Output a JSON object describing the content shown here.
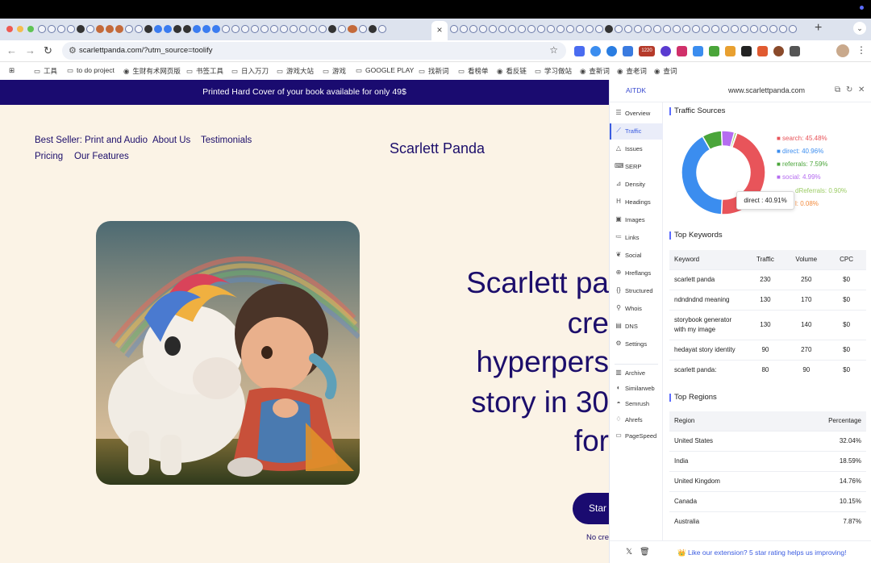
{
  "browser": {
    "active_tab_close": "×",
    "new_tab": "+",
    "tab_menu": "⌄",
    "url": "scarlettpanda.com/?utm_source=toolify",
    "bookmarks": [
      {
        "label": "工具"
      },
      {
        "label": "to do project"
      },
      {
        "label": "生财有术网页版"
      },
      {
        "label": "书签工具"
      },
      {
        "label": "日入万刀"
      },
      {
        "label": "游戏大站"
      },
      {
        "label": "游戏"
      },
      {
        "label": "GOOGLE PLAY"
      },
      {
        "label": "找新词"
      },
      {
        "label": "看榜单"
      },
      {
        "label": "看反链"
      },
      {
        "label": "学习做站"
      },
      {
        "label": "查新词"
      },
      {
        "label": "查老词"
      },
      {
        "label": "查词"
      }
    ],
    "extension_badge": "1220"
  },
  "site": {
    "banner": "Printed Hard Cover of your book available for only 49$",
    "nav": {
      "best_seller": "Best Seller: Print and Audio",
      "about": "About Us",
      "testimonials": "Testimonials",
      "pricing": "Pricing",
      "features": "Our Features"
    },
    "logo": "Scarlett Panda",
    "hero_lines": [
      "Scarlett pa",
      "cre",
      "hyperpers",
      "story in 30",
      "for"
    ],
    "cta": "Star",
    "subtext": "No cre"
  },
  "panel": {
    "brand": "AITDK",
    "domain": "www.scarlettpanda.com",
    "nav": [
      {
        "label": "Overview",
        "icon": "list-icon"
      },
      {
        "label": "Traffic",
        "icon": "chart-line-icon",
        "active": true
      },
      {
        "label": "Issues",
        "icon": "warning-icon"
      },
      {
        "label": "SERP",
        "icon": "serp-icon"
      },
      {
        "label": "Density",
        "icon": "density-icon"
      },
      {
        "label": "Headings",
        "icon": "heading-icon"
      },
      {
        "label": "Images",
        "icon": "image-icon"
      },
      {
        "label": "Links",
        "icon": "links-icon"
      },
      {
        "label": "Social",
        "icon": "twitter-icon"
      },
      {
        "label": "Hreflangs",
        "icon": "globe-icon"
      },
      {
        "label": "Structured",
        "icon": "braces-icon"
      },
      {
        "label": "Whois",
        "icon": "user-search-icon"
      },
      {
        "label": "DNS",
        "icon": "dns-icon"
      },
      {
        "label": "Settings",
        "icon": "gear-icon"
      },
      {
        "label": "Archive",
        "icon": "archive-icon"
      },
      {
        "label": "Similarweb",
        "icon": "similarweb-icon"
      },
      {
        "label": "Semrush",
        "icon": "semrush-icon"
      },
      {
        "label": "Ahrefs",
        "icon": "ahrefs-icon"
      },
      {
        "label": "PageSpeed",
        "icon": "pagespeed-icon"
      }
    ],
    "traffic_title": "Traffic Sources",
    "keywords_title": "Top Keywords",
    "regions_title": "Top Regions",
    "tooltip": "direct : 40.91%",
    "keyword_headers": [
      "Keyword",
      "Traffic",
      "Volume",
      "CPC"
    ],
    "keywords": [
      {
        "keyword": "scarlett panda",
        "traffic": "230",
        "volume": "250",
        "cpc": "$0"
      },
      {
        "keyword": "ndndndnd meaning",
        "traffic": "130",
        "volume": "170",
        "cpc": "$0"
      },
      {
        "keyword": "storybook generator with my image",
        "traffic": "130",
        "volume": "140",
        "cpc": "$0"
      },
      {
        "keyword": "hedayat story identity",
        "traffic": "90",
        "volume": "270",
        "cpc": "$0"
      },
      {
        "keyword": "scarlett panda:",
        "traffic": "80",
        "volume": "90",
        "cpc": "$0"
      }
    ],
    "region_headers": [
      "Region",
      "Percentage"
    ],
    "regions": [
      {
        "region": "United States",
        "pct": "32.04%"
      },
      {
        "region": "India",
        "pct": "18.59%"
      },
      {
        "region": "United Kingdom",
        "pct": "14.76%"
      },
      {
        "region": "Canada",
        "pct": "10.15%"
      },
      {
        "region": "Australia",
        "pct": "7.87%"
      }
    ],
    "footer_message": "👑 Like our extension? 5 star rating helps us improving!"
  },
  "chart_data": {
    "type": "pie",
    "donut": true,
    "categories": [
      "search",
      "direct",
      "referrals",
      "social",
      "paidReferrals",
      "mail"
    ],
    "values": [
      45.48,
      40.96,
      7.59,
      4.99,
      0.9,
      0.08
    ],
    "legend_text": [
      "search: 45.48%",
      "direct: 40.96%",
      "referrals: 7.59%",
      "social: 4.99%",
      "dReferrals: 0.90%",
      "l: 0.08%"
    ],
    "colors": [
      "#e8545a",
      "#3b8def",
      "#4aa53a",
      "#b56cf0",
      "#9ccc65",
      "#f28a3c"
    ],
    "legend_placement": "right"
  }
}
